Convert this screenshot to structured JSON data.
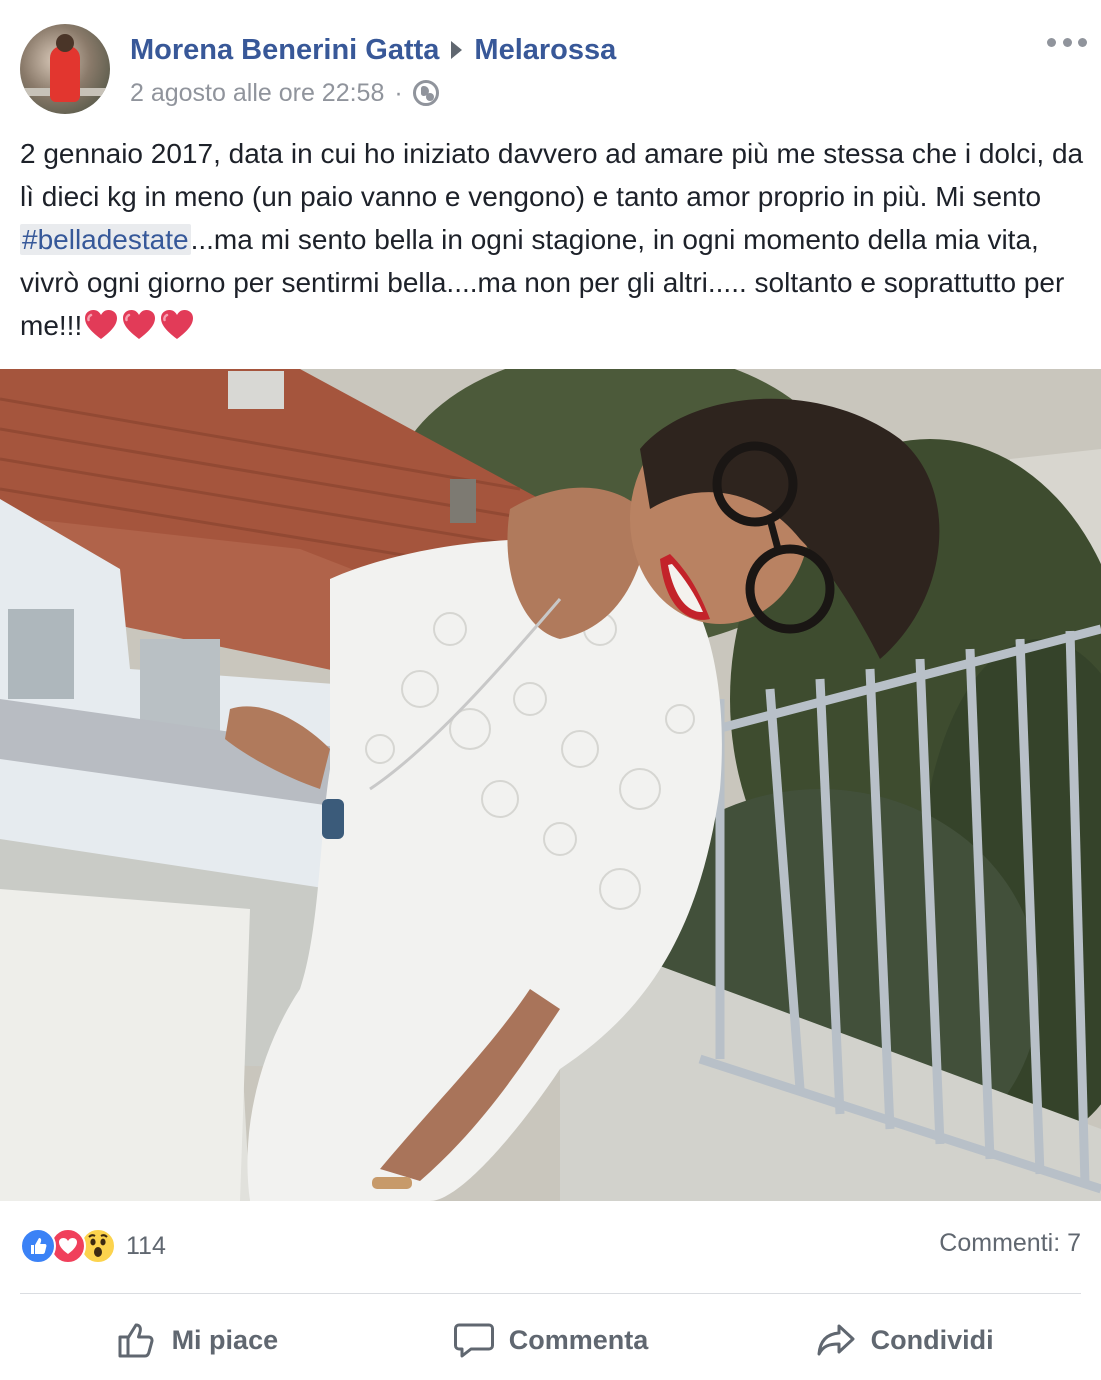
{
  "post": {
    "author": "Morena Benerini Gatta",
    "target": "Melarossa",
    "date": "2 agosto alle ore 22:58",
    "separator": "·",
    "privacy_icon": "globe-icon",
    "more_icon": "more-options-icon",
    "text": {
      "part1": "2 gennaio 2017, data in cui ho iniziato davvero ad amare più me stessa che i dolci, da lì dieci kg in meno (un paio vanno e vengono) e tanto amor proprio in più. Mi sento ",
      "hashtag": "#belladestate",
      "part2": "...ma mi sento bella in ogni stagione, in ogni momento della mia vita, vivrò ogni giorno per sentirmi bella....ma non per gli altri..... soltanto e soprattutto per me!!!"
    },
    "emoji": [
      "heart-emoji",
      "heart-emoji",
      "heart-emoji"
    ]
  },
  "reactions": {
    "icons": [
      "like-reaction-icon",
      "love-reaction-icon",
      "wow-reaction-icon"
    ],
    "count": "114",
    "comments": "Commenti: 7"
  },
  "actions": {
    "like": "Mi piace",
    "comment": "Commenta",
    "share": "Condividi"
  },
  "colors": {
    "link": "#385898",
    "secondary_text": "#90949c",
    "action_text": "#606770",
    "like_blue": "#3b82f6",
    "love_red": "#f0405b",
    "wow_yellow": "#fcd34d"
  }
}
